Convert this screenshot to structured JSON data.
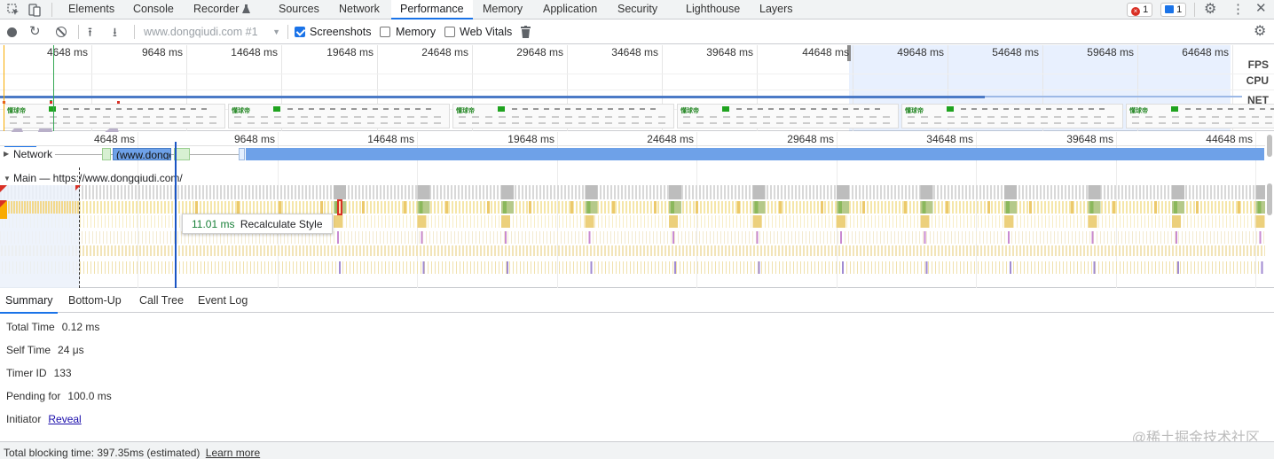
{
  "tabs": [
    "Elements",
    "Console",
    "Recorder",
    "Sources",
    "Network",
    "Performance",
    "Memory",
    "Application",
    "Security",
    "Lighthouse",
    "Layers"
  ],
  "active_tab": "Performance",
  "recorder_icon": "flask-icon",
  "badges": {
    "errors": "1",
    "messages": "1"
  },
  "toolbar": {
    "recording_select": "www.dongqiudi.com #1",
    "screenshots_label": "Screenshots",
    "screenshots_checked": true,
    "memory_label": "Memory",
    "memory_checked": false,
    "webvitals_label": "Web Vitals",
    "webvitals_checked": false
  },
  "overview": {
    "ticks": [
      "4648 ms",
      "9648 ms",
      "14648 ms",
      "19648 ms",
      "24648 ms",
      "29648 ms",
      "34648 ms",
      "39648 ms",
      "44648 ms",
      "49648 ms",
      "54648 ms",
      "59648 ms",
      "64648 ms"
    ],
    "labels": {
      "fps": "FPS",
      "cpu": "CPU",
      "net": "NET"
    },
    "screenshot_logo": "懂球帝"
  },
  "flame": {
    "ticks": [
      "4648 ms",
      "9648 ms",
      "14648 ms",
      "19648 ms",
      "24648 ms",
      "29648 ms",
      "34648 ms",
      "39648 ms",
      "44648 ms"
    ],
    "network_label": "Network",
    "network_request": "(www.dongqiudi",
    "main_label": "Main — https://www.dongqiudi.com/",
    "tooltip_time": "11.01 ms",
    "tooltip_name": "Recalculate Style"
  },
  "bottom_tabs": [
    "Summary",
    "Bottom-Up",
    "Call Tree",
    "Event Log"
  ],
  "summary": {
    "total_time_label": "Total Time",
    "total_time": "0.12 ms",
    "self_time_label": "Self Time",
    "self_time": "24 μs",
    "timer_id_label": "Timer ID",
    "timer_id": "133",
    "pending_label": "Pending for",
    "pending": "100.0 ms",
    "initiator_label": "Initiator",
    "initiator_link": "Reveal"
  },
  "status": {
    "text": "Total blocking time: 397.35ms (estimated)",
    "learn_more": "Learn more"
  },
  "watermark": "@稀土掘金技术社区"
}
